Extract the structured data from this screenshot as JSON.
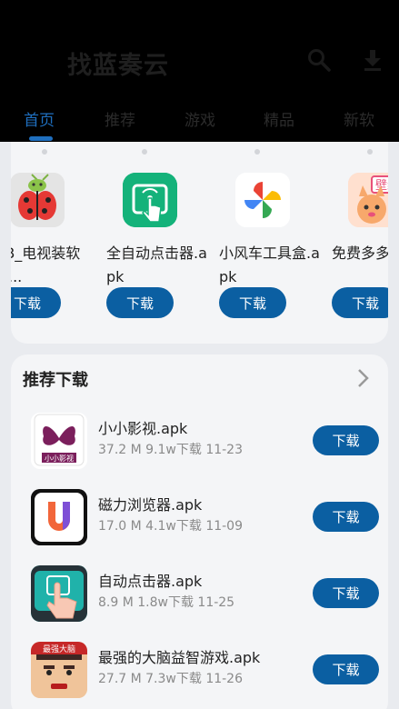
{
  "header": {
    "title": "找蓝奏云",
    "search_icon": "search-icon",
    "download_icon": "download-icon"
  },
  "tabs": [
    {
      "label": "首页",
      "active": true
    },
    {
      "label": "推荐",
      "active": false
    },
    {
      "label": "游戏",
      "active": false
    },
    {
      "label": "精品",
      "active": false
    },
    {
      "label": "新软",
      "active": false
    }
  ],
  "featured": [
    {
      "name": "DB_电视装软件...",
      "button": "下载",
      "icon": "ladybug-android-icon"
    },
    {
      "name": "全自动点击器.apk",
      "button": "下载",
      "icon": "tap-hand-icon"
    },
    {
      "name": "小风车工具盒.apk",
      "button": "下载",
      "icon": "pinwheel-icon"
    },
    {
      "name": "免费多多纸.apk",
      "button": "下载",
      "icon": "cartoon-wallpaper-icon"
    }
  ],
  "recommend": {
    "title": "推荐下载",
    "more_icon": "chevron-right-icon",
    "items": [
      {
        "name": "小小影视.apk",
        "meta": "37.2 M  9.1w下载  11-23",
        "button": "下载",
        "icon": "butterfly-video-icon"
      },
      {
        "name": "磁力浏览器.apk",
        "meta": "17.0 M  4.1w下载  11-09",
        "button": "下载",
        "icon": "u-browser-icon"
      },
      {
        "name": "自动点击器.apk",
        "meta": "8.9 M  1.8w下载  11-25",
        "button": "下载",
        "icon": "auto-clicker-icon"
      },
      {
        "name": "最强的大脑益智游戏.apk",
        "meta": "27.7 M  7.3w下载  11-26",
        "button": "下载",
        "icon": "brain-game-icon"
      }
    ]
  },
  "colors": {
    "accent": "#1f6fbf",
    "button": "#0b5fa2",
    "background": "#e9ebef",
    "card": "#f4f5f7"
  }
}
